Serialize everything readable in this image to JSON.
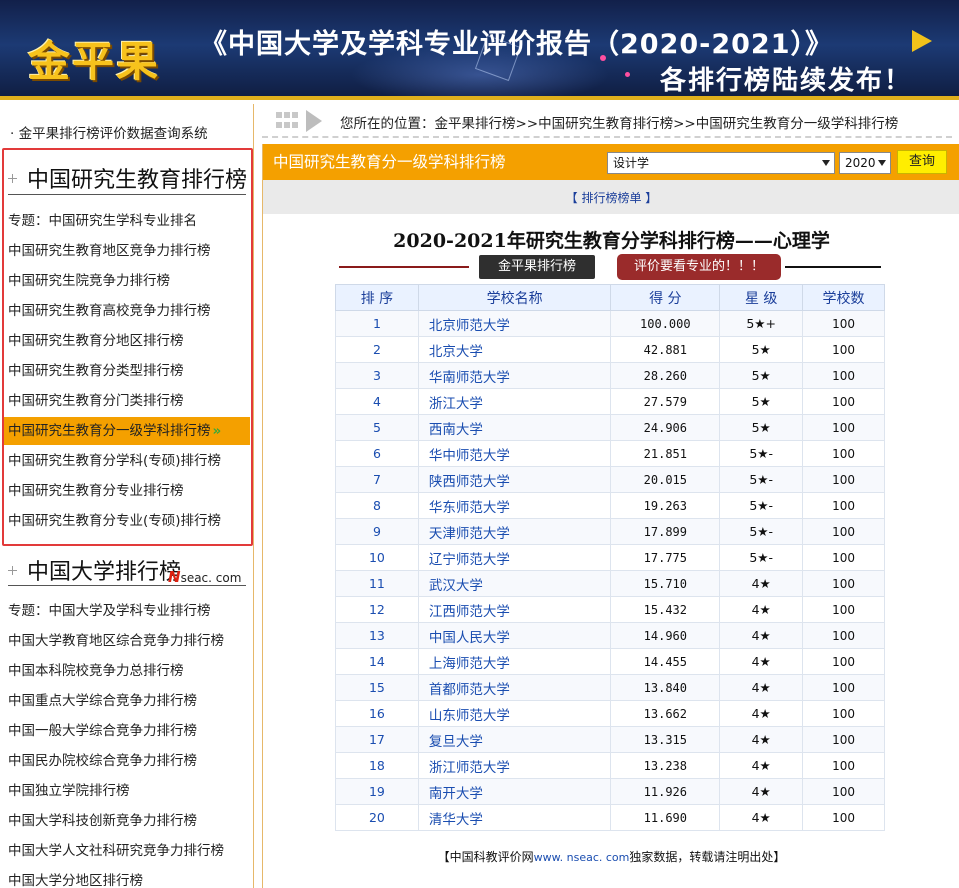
{
  "banner": {
    "logo": "金平果",
    "headline": "《中国大学及学科专业评价报告（2020-2021）》",
    "subline": "各排行榜陆续发布！"
  },
  "sidebar": {
    "top_link": "· 金平果排行榜评价数据查询系统",
    "graduate_section": {
      "title": "中国研究生教育排行榜",
      "items": [
        {
          "label": "专题：中国研究生学科专业排名"
        },
        {
          "label": "中国研究生教育地区竞争力排行榜"
        },
        {
          "label": "中国研究生院竞争力排行榜"
        },
        {
          "label": "中国研究生教育高校竞争力排行榜"
        },
        {
          "label": "中国研究生教育分地区排行榜"
        },
        {
          "label": "中国研究生教育分类型排行榜"
        },
        {
          "label": "中国研究生教育分门类排行榜"
        },
        {
          "label": "中国研究生教育分一级学科排行榜",
          "chev": "»"
        },
        {
          "label": "中国研究生教育分学科(专硕)排行榜"
        },
        {
          "label": "中国研究生教育分专业排行榜"
        },
        {
          "label": "中国研究生教育分专业(专硕)排行榜"
        }
      ]
    },
    "university_section": {
      "title": "中国大学排行榜",
      "brand_n": "N",
      "brand_rest": "seac. com",
      "items": [
        {
          "label": "专题：中国大学及学科专业排行榜"
        },
        {
          "label": "中国大学教育地区综合竞争力排行榜"
        },
        {
          "label": "中国本科院校竞争力总排行榜"
        },
        {
          "label": "中国重点大学综合竞争力排行榜"
        },
        {
          "label": "中国一般大学综合竞争力排行榜"
        },
        {
          "label": "中国民办院校综合竞争力排行榜"
        },
        {
          "label": "中国独立学院排行榜"
        },
        {
          "label": "中国大学科技创新竞争力排行榜"
        },
        {
          "label": "中国大学人文社科研究竞争力排行榜"
        },
        {
          "label": "中国大学分地区排行榜"
        }
      ]
    }
  },
  "breadcrumb": {
    "text": "您所在的位置：金平果排行榜>>中国研究生教育排行榜>>中国研究生教育分一级学科排行榜"
  },
  "panel": {
    "title": "中国研究生教育分一级学科排行榜",
    "subject_select": "设计学",
    "year_select": "2020",
    "query_button": "查询",
    "list_link": "【 排行榜榜单 】",
    "table_title": "2020-2021年研究生教育分学科排行榜——心理学",
    "badge_dark": "金平果排行榜",
    "badge_red": "评价要看专业的！！！"
  },
  "table": {
    "headers": [
      "排 序",
      "学校名称",
      "得 分",
      "星 级",
      "学校数"
    ],
    "rows": [
      {
        "rank": "1",
        "school": "北京师范大学",
        "score": "100.000",
        "stars": "5★+",
        "count": "100"
      },
      {
        "rank": "2",
        "school": "北京大学",
        "score": "42.881",
        "stars": "5★",
        "count": "100"
      },
      {
        "rank": "3",
        "school": "华南师范大学",
        "score": "28.260",
        "stars": "5★",
        "count": "100"
      },
      {
        "rank": "4",
        "school": "浙江大学",
        "score": "27.579",
        "stars": "5★",
        "count": "100"
      },
      {
        "rank": "5",
        "school": "西南大学",
        "score": "24.906",
        "stars": "5★",
        "count": "100"
      },
      {
        "rank": "6",
        "school": "华中师范大学",
        "score": "21.851",
        "stars": "5★-",
        "count": "100"
      },
      {
        "rank": "7",
        "school": "陕西师范大学",
        "score": "20.015",
        "stars": "5★-",
        "count": "100"
      },
      {
        "rank": "8",
        "school": "华东师范大学",
        "score": "19.263",
        "stars": "5★-",
        "count": "100"
      },
      {
        "rank": "9",
        "school": "天津师范大学",
        "score": "17.899",
        "stars": "5★-",
        "count": "100"
      },
      {
        "rank": "10",
        "school": "辽宁师范大学",
        "score": "17.775",
        "stars": "5★-",
        "count": "100"
      },
      {
        "rank": "11",
        "school": "武汉大学",
        "score": "15.710",
        "stars": "4★",
        "count": "100"
      },
      {
        "rank": "12",
        "school": "江西师范大学",
        "score": "15.432",
        "stars": "4★",
        "count": "100"
      },
      {
        "rank": "13",
        "school": "中国人民大学",
        "score": "14.960",
        "stars": "4★",
        "count": "100"
      },
      {
        "rank": "14",
        "school": "上海师范大学",
        "score": "14.455",
        "stars": "4★",
        "count": "100"
      },
      {
        "rank": "15",
        "school": "首都师范大学",
        "score": "13.840",
        "stars": "4★",
        "count": "100"
      },
      {
        "rank": "16",
        "school": "山东师范大学",
        "score": "13.662",
        "stars": "4★",
        "count": "100"
      },
      {
        "rank": "17",
        "school": "复旦大学",
        "score": "13.315",
        "stars": "4★",
        "count": "100"
      },
      {
        "rank": "18",
        "school": "浙江师范大学",
        "score": "13.238",
        "stars": "4★",
        "count": "100"
      },
      {
        "rank": "19",
        "school": "南开大学",
        "score": "11.926",
        "stars": "4★",
        "count": "100"
      },
      {
        "rank": "20",
        "school": "清华大学",
        "score": "11.690",
        "stars": "4★",
        "count": "100"
      }
    ]
  },
  "footer": {
    "prefix": "【中国科教评价网",
    "url": "www. nseac. com",
    "suffix": "独家数据，转载请注明出处】"
  },
  "colors": {
    "accent_orange": "#f4a000",
    "highlight_red_box": "#e23a3a",
    "link_blue": "#1a4db0",
    "query_yellow": "#ffee00"
  },
  "icons": {
    "section_bullet": "plus-bullet-icon",
    "breadcrumb": "arrow-right-icon",
    "select_caret": "caret-down-icon"
  }
}
